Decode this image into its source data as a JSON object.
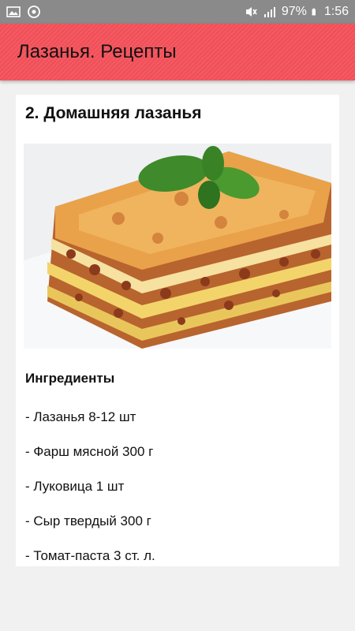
{
  "status_bar": {
    "battery": "97%",
    "time": "1:56",
    "icons": [
      "gallery-icon",
      "sync-icon",
      "mute-icon",
      "signal-icon",
      "battery-icon"
    ]
  },
  "app_bar": {
    "title": "Лазанья. Рецепты",
    "color": "#f4515a"
  },
  "recipe": {
    "title": "2. Домашняя лазанья",
    "photo": "lasagna-image",
    "ingredients_heading": "Ингредиенты",
    "ingredients": [
      "- Лазанья 8-12 шт",
      "- Фарш мясной 300 г",
      "- Луковица 1 шт",
      "- Сыр твердый 300 г",
      "- Томат-паста 3 ст. л."
    ]
  }
}
